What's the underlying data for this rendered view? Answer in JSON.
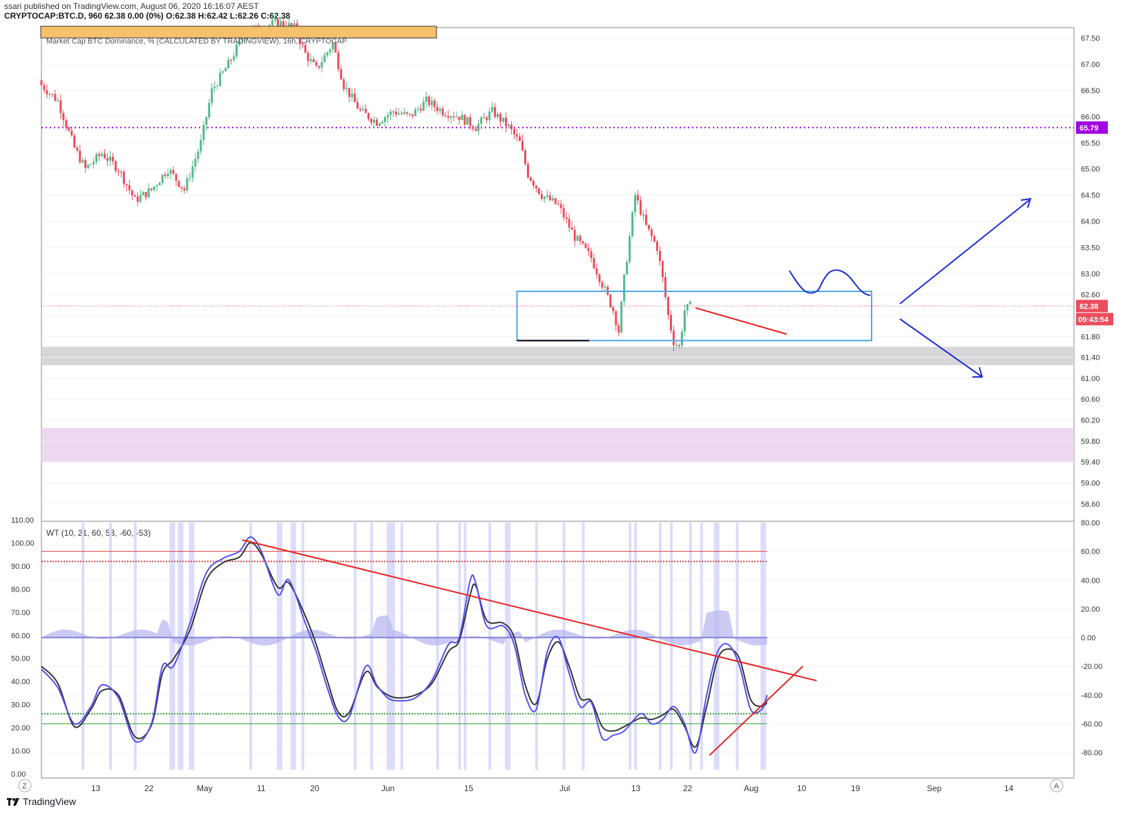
{
  "header": {
    "line1": "ssari published on TradingView.com, August 06, 2020 16:16:07 AEST",
    "line2": "CRYPTOCAP:BTC.D, 960  62.38  0.00 (0%)  O:62.38  H:62.42  L:62.26  C:62.38"
  },
  "footer": {
    "brand": "TradingView"
  },
  "buttons": {
    "zoom": "Z",
    "auto": "A"
  },
  "colors": {
    "up": "#53b987",
    "down": "#eb4d5c",
    "wt1": "#5050f0",
    "wt2": "#333333",
    "box": "#4aa8e8",
    "trend": "#e82020",
    "drawing": "#1a2ad8",
    "level_line": "#a000e0",
    "gray_zone": "#d5d5d8",
    "purple_zone": "#ecd3f0"
  },
  "chart_data": [
    {
      "type": "candlestick",
      "title": "Market Cap BTC Dominance, % (CALCULATED BY TRADINGVIEW), 16h, CRYPTOCAP",
      "ylim": [
        58.4,
        67.7
      ],
      "y_ticks": [
        "67.50",
        "67.00",
        "66.50",
        "66.00",
        "65.50",
        "65.00",
        "64.50",
        "64.00",
        "63.50",
        "63.00",
        "62.60",
        "62.20",
        "61.80",
        "61.40",
        "61.00",
        "60.60",
        "60.20",
        "59.80",
        "59.40",
        "59.00",
        "58.60"
      ],
      "x_ticks": [
        "13",
        "22",
        "May",
        "11",
        "20",
        "Jun",
        "15",
        "Jul",
        "13",
        "22",
        "Aug",
        "10",
        "19",
        "Sep",
        "14"
      ],
      "marked_level": {
        "label": "65.79",
        "value": 65.79
      },
      "current_price": {
        "label": "62.38",
        "value": 62.38,
        "countdown": "09:43:54"
      },
      "close_path": [
        [
          0,
          66.6
        ],
        [
          6,
          66.3
        ],
        [
          12,
          65.4
        ],
        [
          16,
          65.0
        ],
        [
          22,
          65.3
        ],
        [
          28,
          65.0
        ],
        [
          34,
          64.4
        ],
        [
          40,
          64.6
        ],
        [
          46,
          65.0
        ],
        [
          52,
          64.6
        ],
        [
          58,
          65.5
        ],
        [
          62,
          66.5
        ],
        [
          68,
          67.0
        ],
        [
          74,
          67.6
        ],
        [
          80,
          67.7
        ],
        [
          86,
          67.8
        ],
        [
          92,
          67.7
        ],
        [
          96,
          67.2
        ],
        [
          100,
          66.9
        ],
        [
          106,
          67.4
        ],
        [
          110,
          66.6
        ],
        [
          116,
          66.1
        ],
        [
          122,
          65.9
        ],
        [
          128,
          66.1
        ],
        [
          134,
          66.0
        ],
        [
          140,
          66.3
        ],
        [
          146,
          66.1
        ],
        [
          152,
          66.0
        ],
        [
          158,
          65.8
        ],
        [
          164,
          66.1
        ],
        [
          170,
          65.8
        ],
        [
          174,
          65.5
        ],
        [
          177,
          64.9
        ],
        [
          182,
          64.5
        ],
        [
          188,
          64.3
        ],
        [
          194,
          63.7
        ],
        [
          200,
          63.3
        ],
        [
          204,
          62.8
        ],
        [
          208,
          62.3
        ],
        [
          210,
          61.9
        ],
        [
          212,
          62.9
        ],
        [
          216,
          64.5
        ],
        [
          220,
          63.9
        ],
        [
          224,
          63.5
        ],
        [
          226,
          62.9
        ],
        [
          228,
          62.2
        ],
        [
          230,
          61.7
        ],
        [
          232,
          61.6
        ],
        [
          234,
          62.3
        ],
        [
          236,
          62.38
        ]
      ],
      "zones": [
        {
          "name": "gray support zone",
          "from": 61.25,
          "to": 61.6
        },
        {
          "name": "purple zone",
          "from": 59.4,
          "to": 60.05
        }
      ],
      "box": {
        "x_from": 173,
        "x_to": 302,
        "y_from": 61.72,
        "y_to": 62.66
      }
    },
    {
      "type": "line",
      "title": "WT (10, 21, 60, 53, -60, -53)",
      "ylim": [
        -92,
        80
      ],
      "y_ticks_right": [
        "80.00",
        "60.00",
        "40.00",
        "20.00",
        "0.00",
        "-20.00",
        "-40.00",
        "-60.00",
        "-80.00"
      ],
      "y_ticks_left": [
        "110.00",
        "100.00",
        "90.00",
        "80.00",
        "70.00",
        "60.00",
        "50.00",
        "40.00",
        "30.00",
        "20.00",
        "10.00",
        "0.00"
      ],
      "levels": [
        60,
        53,
        -53,
        -60
      ],
      "series": [
        {
          "values": [
            [
              0,
              -22
            ],
            [
              6,
              -35
            ],
            [
              12,
              -60
            ],
            [
              18,
              -48
            ],
            [
              22,
              -33
            ],
            [
              28,
              -42
            ],
            [
              34,
              -72
            ],
            [
              40,
              -60
            ],
            [
              44,
              -20
            ],
            [
              48,
              -20
            ],
            [
              54,
              10
            ],
            [
              60,
              45
            ],
            [
              66,
              55
            ],
            [
              72,
              60
            ],
            [
              76,
              70
            ],
            [
              80,
              60
            ],
            [
              86,
              30
            ],
            [
              90,
              40
            ],
            [
              96,
              10
            ],
            [
              100,
              -10
            ],
            [
              104,
              -35
            ],
            [
              108,
              -55
            ],
            [
              112,
              -55
            ],
            [
              118,
              -20
            ],
            [
              122,
              -33
            ],
            [
              126,
              -42
            ],
            [
              130,
              -44
            ],
            [
              136,
              -42
            ],
            [
              142,
              -30
            ],
            [
              148,
              -5
            ],
            [
              152,
              0
            ],
            [
              156,
              40
            ],
            [
              158,
              38
            ],
            [
              162,
              8
            ],
            [
              168,
              8
            ],
            [
              172,
              -5
            ],
            [
              176,
              -40
            ],
            [
              180,
              -50
            ],
            [
              184,
              -10
            ],
            [
              188,
              0
            ],
            [
              192,
              -25
            ],
            [
              196,
              -48
            ],
            [
              200,
              -45
            ],
            [
              204,
              -70
            ],
            [
              208,
              -68
            ],
            [
              212,
              -65
            ],
            [
              218,
              -53
            ],
            [
              222,
              -60
            ],
            [
              226,
              -57
            ],
            [
              230,
              -48
            ],
            [
              234,
              -60
            ],
            [
              238,
              -80
            ],
            [
              242,
              -40
            ],
            [
              246,
              -10
            ],
            [
              250,
              -5
            ],
            [
              254,
              -20
            ],
            [
              258,
              -50
            ],
            [
              262,
              -50
            ],
            [
              264,
              -40
            ]
          ]
        },
        {
          "values": [
            [
              0,
              -20
            ],
            [
              6,
              -32
            ],
            [
              12,
              -62
            ],
            [
              18,
              -50
            ],
            [
              22,
              -37
            ],
            [
              28,
              -40
            ],
            [
              34,
              -69
            ],
            [
              40,
              -61
            ],
            [
              44,
              -25
            ],
            [
              48,
              -15
            ],
            [
              54,
              5
            ],
            [
              60,
              40
            ],
            [
              66,
              52
            ],
            [
              72,
              56
            ],
            [
              76,
              66
            ],
            [
              80,
              58
            ],
            [
              86,
              35
            ],
            [
              90,
              38
            ],
            [
              96,
              15
            ],
            [
              100,
              -5
            ],
            [
              104,
              -30
            ],
            [
              108,
              -52
            ],
            [
              112,
              -52
            ],
            [
              118,
              -24
            ],
            [
              122,
              -34
            ],
            [
              126,
              -40
            ],
            [
              130,
              -42
            ],
            [
              136,
              -40
            ],
            [
              142,
              -32
            ],
            [
              148,
              -10
            ],
            [
              152,
              -2
            ],
            [
              156,
              30
            ],
            [
              158,
              36
            ],
            [
              162,
              12
            ],
            [
              168,
              10
            ],
            [
              172,
              0
            ],
            [
              176,
              -33
            ],
            [
              180,
              -46
            ],
            [
              184,
              -15
            ],
            [
              188,
              -3
            ],
            [
              192,
              -20
            ],
            [
              196,
              -42
            ],
            [
              200,
              -44
            ],
            [
              204,
              -62
            ],
            [
              208,
              -65
            ],
            [
              212,
              -62
            ],
            [
              218,
              -56
            ],
            [
              222,
              -57
            ],
            [
              226,
              -54
            ],
            [
              230,
              -50
            ],
            [
              234,
              -62
            ],
            [
              238,
              -76
            ],
            [
              242,
              -48
            ],
            [
              246,
              -15
            ],
            [
              250,
              -8
            ],
            [
              254,
              -15
            ],
            [
              258,
              -43
            ],
            [
              262,
              -48
            ],
            [
              264,
              -45
            ]
          ]
        }
      ],
      "trend_lines": [
        {
          "from": [
            73,
            68
          ],
          "to": [
            282,
            -30
          ]
        },
        {
          "from": [
            243,
            -82
          ],
          "to": [
            277,
            -20
          ]
        }
      ]
    }
  ]
}
